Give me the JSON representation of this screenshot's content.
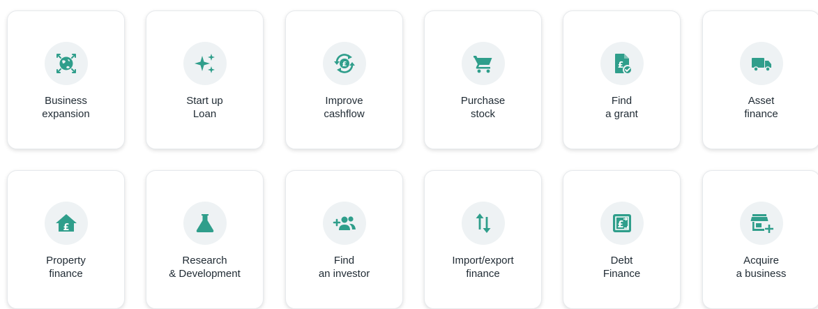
{
  "accent": "#2f9e8b",
  "cards": [
    {
      "icon": "globe-expand-icon",
      "line1": "Business",
      "line2": "expansion"
    },
    {
      "icon": "sparkles-icon",
      "line1": "Start up",
      "line2": "Loan"
    },
    {
      "icon": "pound-cycle-icon",
      "line1": "Improve",
      "line2": "cashflow"
    },
    {
      "icon": "shopping-cart-icon",
      "line1": "Purchase",
      "line2": "stock"
    },
    {
      "icon": "grant-document-icon",
      "line1": "Find",
      "line2": "a grant"
    },
    {
      "icon": "truck-icon",
      "line1": "Asset",
      "line2": "finance"
    },
    {
      "icon": "house-pound-icon",
      "line1": "Property",
      "line2": "finance"
    },
    {
      "icon": "flask-icon",
      "line1": "Research",
      "line2": "& Development"
    },
    {
      "icon": "add-people-icon",
      "line1": "Find",
      "line2": "an investor"
    },
    {
      "icon": "up-down-arrows-icon",
      "line1": "Import/export",
      "line2": "finance"
    },
    {
      "icon": "pound-exchange-icon",
      "line1": "Debt",
      "line2": "Finance"
    },
    {
      "icon": "store-add-icon",
      "line1": "Acquire",
      "line2": "a business"
    }
  ]
}
